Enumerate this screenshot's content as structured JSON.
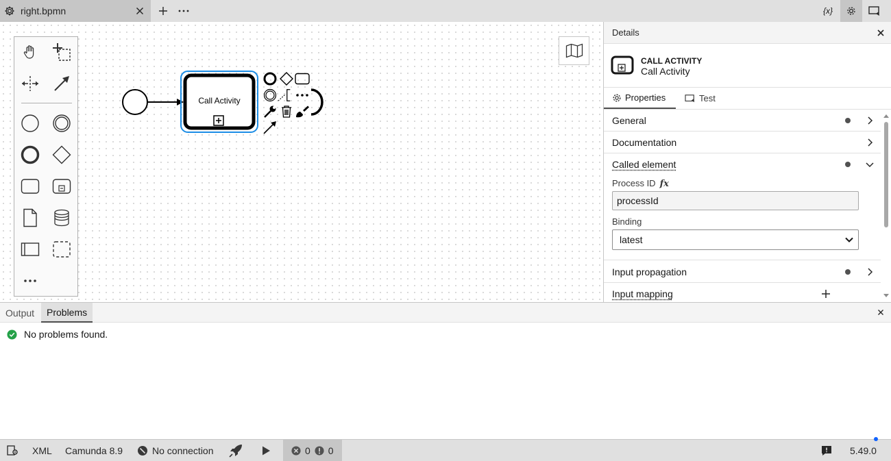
{
  "tabs": {
    "active_tab_label": "right.bpmn",
    "add_tab": "+",
    "more": "···",
    "variables_icon_label": "{x}"
  },
  "palette": {
    "tools": [
      "hand-tool",
      "lasso-tool",
      "space-tool",
      "connect-tool",
      "start-event",
      "intermediate-event",
      "end-event",
      "gateway",
      "task",
      "subprocess",
      "data-object",
      "data-store",
      "pool",
      "group"
    ],
    "more": "•••"
  },
  "diagram": {
    "task_label": "Call Activity",
    "selected_color": "#1b8ce5"
  },
  "details": {
    "title": "Details",
    "element_type": "CALL ACTIVITY",
    "element_name": "Call Activity",
    "tabs": [
      "Properties",
      "Test"
    ],
    "groups": {
      "general": "General",
      "documentation": "Documentation",
      "called_element": "Called element",
      "input_propagation": "Input propagation",
      "input_mapping": "Input mapping"
    },
    "process_id_label": "Process ID",
    "fx_label": "fx",
    "process_id_value": "processId",
    "binding_label": "Binding",
    "binding_value": "latest"
  },
  "log": {
    "tabs": [
      "Output",
      "Problems"
    ],
    "active_tab": "Problems",
    "message": "No problems found."
  },
  "statusbar": {
    "xml": "XML",
    "engine": "Camunda 8.9",
    "connection": "No connection",
    "errors": "0",
    "warnings": "0",
    "version": "5.49.0"
  },
  "colors": {
    "success": "#24a148",
    "accent": "#0f62fe"
  }
}
